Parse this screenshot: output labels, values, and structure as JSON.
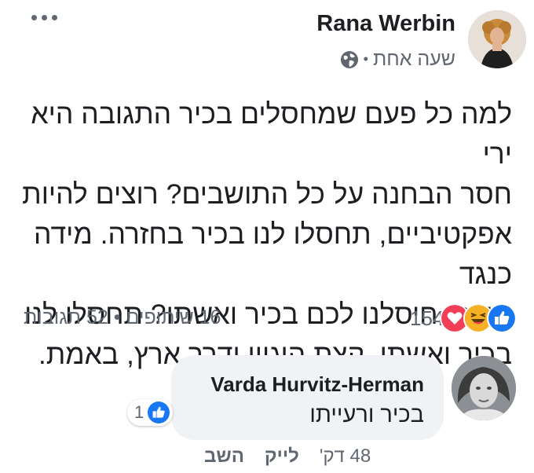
{
  "post": {
    "author_name": "Rana Werbin",
    "timestamp": "שעה אחת",
    "separator": "•",
    "privacy_icon": "globe-icon",
    "lines": [
      "למה כל פעם שמחסלים בכיר התגובה היא ירי",
      "חסר הבחנה על כל התושבים? רוצים להיות",
      "אפקטיביים, תחסלו לנו בכיר בחזרה. מידה כנגד",
      "מידה. חיסלנו לכם בכיר ואשתו? תחסלו לנו",
      "בכיר ואשתו. קצת היגיון ודרך ארץ, באמת."
    ]
  },
  "stats": {
    "reaction_count": "154",
    "reaction_icons": [
      "like-icon",
      "haha-icon",
      "love-icon"
    ],
    "comments": "52 תגובות",
    "shares": "16 שיתופים",
    "separator": "•"
  },
  "comment": {
    "author_name": "Varda Hurvitz-Herman",
    "text": "בכיר ורעייתו",
    "like_count": "1",
    "time": "48 דק'",
    "like_label": "לייק",
    "reply_label": "השב"
  },
  "colors": {
    "like_blue": "#1877f2",
    "love_red": "#f33e58",
    "haha_yellow": "#f7b125",
    "secondary_text": "#606770",
    "bubble_bg": "#f0f2f5"
  }
}
